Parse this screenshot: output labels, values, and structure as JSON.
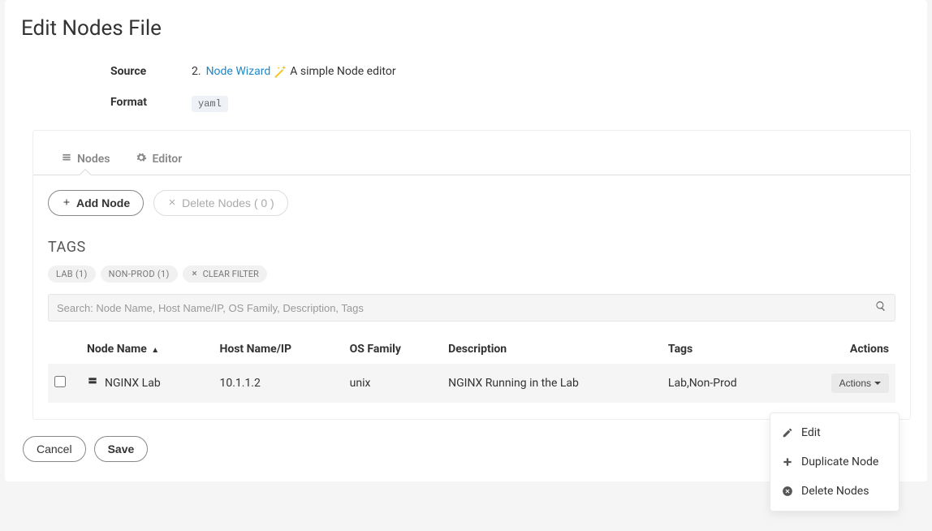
{
  "page_title": "Edit Nodes File",
  "source": {
    "label": "Source",
    "num": "2.",
    "link_text": "Node Wizard",
    "desc": "A simple Node editor"
  },
  "format": {
    "label": "Format",
    "value": "yaml"
  },
  "tabs": {
    "nodes": "Nodes",
    "editor": "Editor"
  },
  "buttons": {
    "add_node": "Add Node",
    "delete_nodes": "Delete Nodes ( 0 )",
    "cancel": "Cancel",
    "save": "Save"
  },
  "tags_section": {
    "heading": "TAGS",
    "tags": [
      "LAB (1)",
      "NON-PROD (1)"
    ],
    "clear": "CLEAR FILTER"
  },
  "search": {
    "placeholder": "Search: Node Name, Host Name/IP, OS Family, Description, Tags"
  },
  "table": {
    "headers": {
      "node_name": "Node Name",
      "host": "Host Name/IP",
      "os": "OS Family",
      "desc": "Description",
      "tags": "Tags",
      "actions": "Actions",
      "sort_indicator": "▲"
    },
    "rows": [
      {
        "node_name": "NGINX Lab",
        "host": "10.1.1.2",
        "os": "unix",
        "desc": "NGINX Running in the Lab",
        "tags": "Lab,Non-Prod",
        "actions_label": "Actions"
      }
    ]
  },
  "dropdown": {
    "edit": "Edit",
    "duplicate": "Duplicate Node",
    "delete": "Delete Nodes"
  }
}
